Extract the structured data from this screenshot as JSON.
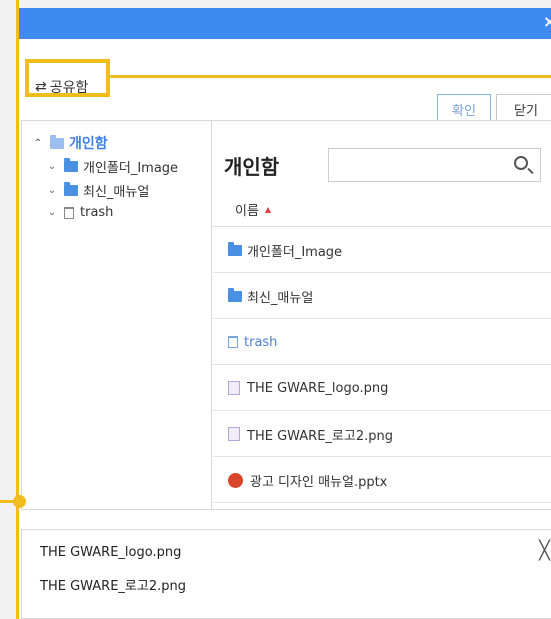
{
  "dialog": {
    "close_glyph": "×"
  },
  "topbar": {
    "share_icon": "⇄",
    "share_label": "공유함",
    "ok_label": "확인",
    "close_label": "닫기"
  },
  "tree": {
    "root": {
      "label": "개인함",
      "chevron": "⌃",
      "icon": "folder-icon"
    },
    "items": [
      {
        "label": "개인폴더_Image",
        "chevron": "⌄",
        "icon": "folder-icon"
      },
      {
        "label": "최신_매뉴얼",
        "chevron": "⌄",
        "icon": "folder-icon"
      },
      {
        "label": "trash",
        "chevron": "⌄",
        "icon": "trash-icon"
      }
    ]
  },
  "pane": {
    "title": "개인함",
    "search_placeholder": "",
    "column_name": "이름",
    "sort_arrow": "▲",
    "rows": [
      {
        "name": "개인폴더_Image",
        "type": "folder"
      },
      {
        "name": "최신_매뉴얼",
        "type": "folder"
      },
      {
        "name": "trash",
        "type": "trash"
      },
      {
        "name": "THE GWARE_logo.png",
        "type": "png"
      },
      {
        "name": "THE GWARE_로고2.png",
        "type": "png"
      },
      {
        "name": "광고 디자인 매뉴얼.pptx",
        "type": "pptx"
      }
    ]
  },
  "selected": {
    "items": [
      "THE GWARE_logo.png",
      "THE GWARE_로고2.png"
    ],
    "clear_glyph": "╳"
  },
  "colors": {
    "accent": "#3e8bf0",
    "highlight": "#f2bd1c",
    "folder": "#4a90e2",
    "sort_arrow": "#e23c3c"
  }
}
